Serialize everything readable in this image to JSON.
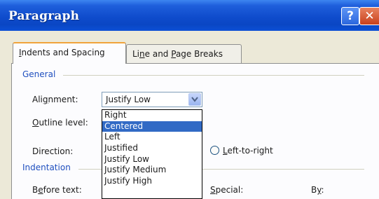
{
  "window": {
    "title": "Paragraph"
  },
  "titlebar": {
    "help_label": "?",
    "close_label": "✕"
  },
  "tabs": [
    {
      "label_pre": "",
      "label_u": "I",
      "label_post": "ndents and Spacing",
      "active": true
    },
    {
      "label_pre": "Li",
      "label_u": "n",
      "label_post": "e and ",
      "label_u2": "P",
      "label_post2": "age Breaks",
      "active": false
    }
  ],
  "general": {
    "title": "General",
    "alignment_label_pre": "Ali",
    "alignment_label_u": "g",
    "alignment_label_post": "nment:",
    "alignment_value": "Justify Low",
    "outline_label_u": "O",
    "outline_label_post": "utline level:",
    "direction_label": "Direction:",
    "ltr_label_u": "L",
    "ltr_label_post": "eft-to-right"
  },
  "alignment_options": [
    "Right",
    "Centered",
    "Left",
    "Justified",
    "Justify Low",
    "Justify Medium",
    "Justify High"
  ],
  "alignment_highlighted": "Centered",
  "indentation": {
    "title": "Indentation",
    "before_text_label_pre": "B",
    "before_text_label_u": "e",
    "before_text_label_post": "fore text:",
    "special_label_pre": "",
    "special_label_u": "S",
    "special_label_post": "pecial:",
    "by_label_pre": "B",
    "by_label_u": "y",
    "by_label_post": ":"
  },
  "colors": {
    "titlebar": "#0f4ccc",
    "group_title": "#1f4fbf",
    "selection": "#316ac5",
    "tab_highlight": "#f1a43b"
  }
}
